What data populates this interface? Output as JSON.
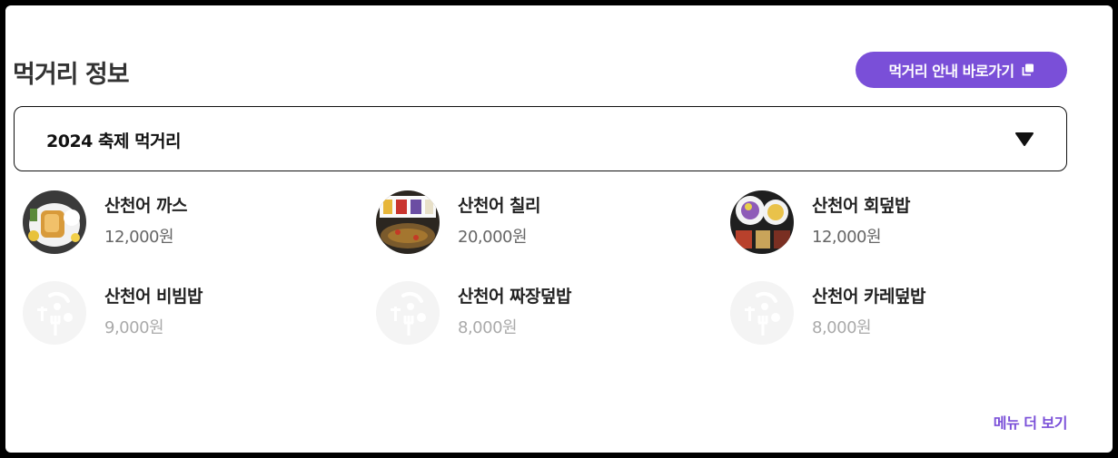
{
  "header": {
    "title": "먹거리 정보",
    "guide_button_label": "먹거리 안내 바로가기"
  },
  "selector": {
    "selected": "2024 축제 먹거리"
  },
  "menu": {
    "items": [
      {
        "name": "산천어 까스",
        "price": "12,000원",
        "has_photo": true
      },
      {
        "name": "산천어 칠리",
        "price": "20,000원",
        "has_photo": true
      },
      {
        "name": "산천어 회덮밥",
        "price": "12,000원",
        "has_photo": true
      },
      {
        "name": "산천어 비빔밥",
        "price": "9,000원",
        "has_photo": false
      },
      {
        "name": "산천어 짜장덮밥",
        "price": "8,000원",
        "has_photo": false
      },
      {
        "name": "산천어 카레덮밥",
        "price": "8,000원",
        "has_photo": false
      }
    ],
    "more_label": "메뉴 더 보기"
  },
  "colors": {
    "accent": "#7a4fd8",
    "placeholder_bg": "#f4f4f4"
  },
  "icons": {
    "guide_button": "external-link-icon",
    "selector": "caret-down-icon",
    "placeholder": "food-placeholder-icon"
  }
}
